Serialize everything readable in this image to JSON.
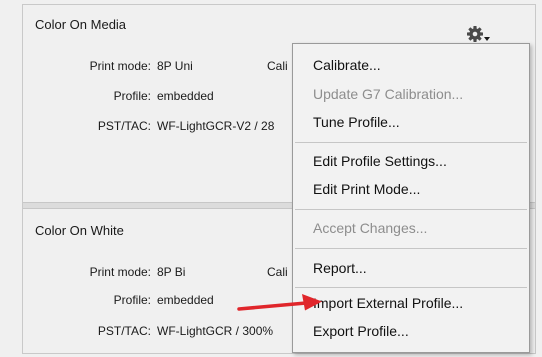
{
  "color_on_media": {
    "title": "Color On Media",
    "print_mode_label": "Print mode:",
    "print_mode_value": "8P Uni",
    "cal_cut": "Cali",
    "profile_label": "Profile:",
    "profile_value": "embedded",
    "pst_label": "PST/TAC:",
    "pst_value": "WF-LightGCR-V2 / 28"
  },
  "color_on_white": {
    "title": "Color On White",
    "print_mode_label": "Print mode:",
    "print_mode_value": "8P Bi",
    "cal_cut": "Cali",
    "profile_label": "Profile:",
    "profile_value": "embedded",
    "pst_label": "PST/TAC:",
    "pst_value": "WF-LightGCR / 300%"
  },
  "menu": {
    "items": [
      {
        "label": "Calibrate...",
        "enabled": true
      },
      {
        "label": "Update G7 Calibration...",
        "enabled": false
      },
      {
        "label": "Tune Profile...",
        "enabled": true
      },
      {
        "label": "Edit Profile Settings...",
        "enabled": true
      },
      {
        "label": "Edit Print Mode...",
        "enabled": true
      },
      {
        "label": "Accept Changes...",
        "enabled": false
      },
      {
        "label": "Report...",
        "enabled": true
      },
      {
        "label": "Import External Profile...",
        "enabled": true
      },
      {
        "label": "Export Profile...",
        "enabled": true
      }
    ]
  },
  "icons": {
    "settings": "gear-icon",
    "dropdown": "chevron-down-icon",
    "pointer": "red-arrow-icon"
  },
  "colors": {
    "arrow": "#e0262b",
    "disabled_text": "#8d8d8d"
  }
}
